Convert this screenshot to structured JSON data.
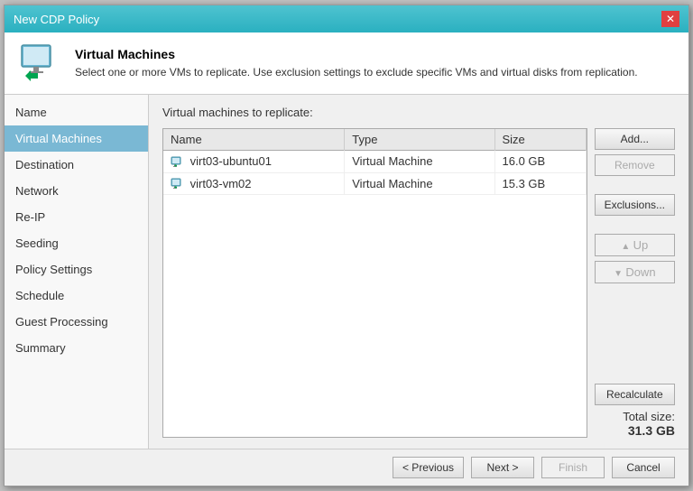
{
  "titleBar": {
    "title": "New CDP Policy",
    "closeLabel": "✕"
  },
  "header": {
    "title": "Virtual Machines",
    "description": "Select one or more VMs to replicate. Use exclusion settings to exclude specific VMs and virtual disks from replication."
  },
  "sidebar": {
    "items": [
      {
        "label": "Name",
        "active": false
      },
      {
        "label": "Virtual Machines",
        "active": true
      },
      {
        "label": "Destination",
        "active": false
      },
      {
        "label": "Network",
        "active": false
      },
      {
        "label": "Re-IP",
        "active": false
      },
      {
        "label": "Seeding",
        "active": false
      },
      {
        "label": "Policy Settings",
        "active": false
      },
      {
        "label": "Schedule",
        "active": false
      },
      {
        "label": "Guest Processing",
        "active": false
      },
      {
        "label": "Summary",
        "active": false
      }
    ]
  },
  "content": {
    "sectionLabel": "Virtual machines to replicate:",
    "tableHeaders": [
      "Name",
      "Type",
      "Size"
    ],
    "vms": [
      {
        "name": "virt03-ubuntu01",
        "type": "Virtual Machine",
        "size": "16.0 GB"
      },
      {
        "name": "virt03-vm02",
        "type": "Virtual Machine",
        "size": "15.3 GB"
      }
    ],
    "buttons": {
      "add": "Add...",
      "remove": "Remove",
      "exclusions": "Exclusions...",
      "up": "Up",
      "down": "Down",
      "recalculate": "Recalculate"
    },
    "totalSizeLabel": "Total size:",
    "totalSizeValue": "31.3 GB"
  },
  "footer": {
    "previous": "< Previous",
    "next": "Next >",
    "finish": "Finish",
    "cancel": "Cancel"
  }
}
